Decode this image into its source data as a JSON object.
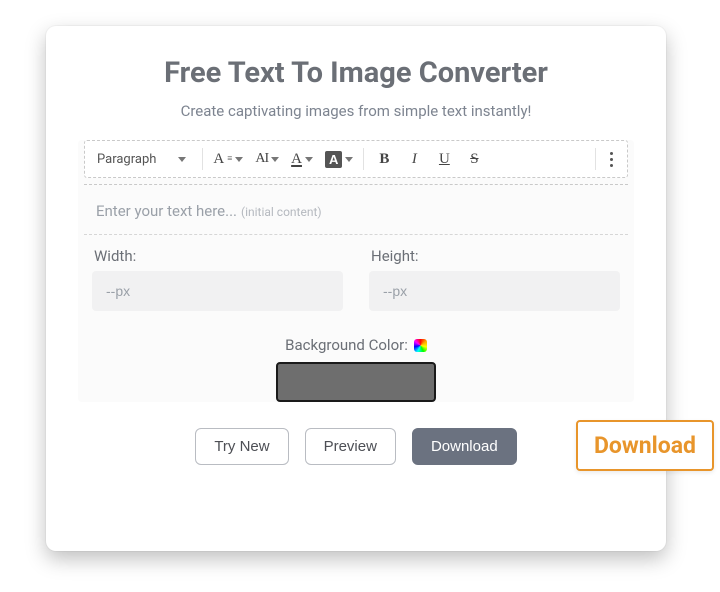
{
  "title": "Free Text To Image Converter",
  "subtitle": "Create captivating images from simple text instantly!",
  "toolbar": {
    "paragraph": "Paragraph",
    "font_btn": "A",
    "case_btn": "AI",
    "color_btn": "A",
    "bg_btn": "A",
    "bold": "B",
    "italic": "I",
    "underline": "U",
    "strike": "S"
  },
  "editor": {
    "placeholder": "Enter your text here...",
    "initial_note": "(initial content)"
  },
  "dims": {
    "width_label": "Width:",
    "height_label": "Height:",
    "placeholder": "--px"
  },
  "bgcolor": {
    "label": "Background Color:",
    "value": "#6e6e6e"
  },
  "buttons": {
    "try_new": "Try New",
    "preview": "Preview",
    "download": "Download"
  },
  "callout": "Download"
}
